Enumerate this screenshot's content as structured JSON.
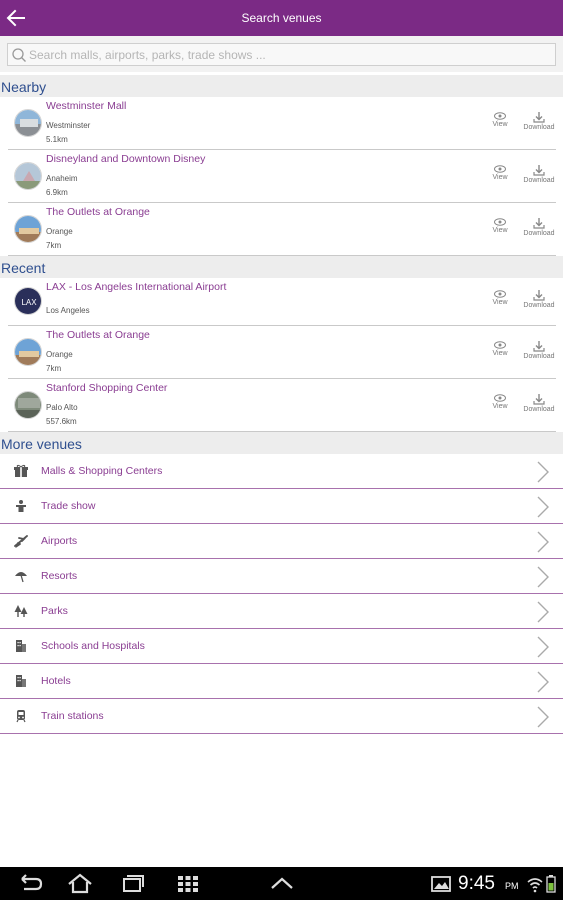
{
  "appbar": {
    "title": "Search venues"
  },
  "search": {
    "placeholder": "Search malls, airports, parks, trade shows ..."
  },
  "sections": {
    "nearby": "Nearby",
    "recent": "Recent",
    "more": "More venues"
  },
  "actions": {
    "view": "View",
    "download": "Download"
  },
  "nearby": [
    {
      "name": "Westminster Mall",
      "city": "Westminster",
      "dist": "5.1km"
    },
    {
      "name": "Disneyland and Downtown Disney",
      "city": "Anaheim",
      "dist": "6.9km"
    },
    {
      "name": "The Outlets at Orange",
      "city": "Orange",
      "dist": "7km"
    }
  ],
  "recent": [
    {
      "name": "LAX - Los Angeles International Airport",
      "city": "Los Angeles",
      "dist": ""
    },
    {
      "name": "The Outlets at Orange",
      "city": "Orange",
      "dist": "7km"
    },
    {
      "name": "Stanford Shopping Center",
      "city": "Palo Alto",
      "dist": "557.6km"
    }
  ],
  "categories": [
    {
      "label": "Malls & Shopping Centers",
      "icon": "gift-icon"
    },
    {
      "label": "Trade show",
      "icon": "podium-icon"
    },
    {
      "label": "Airports",
      "icon": "airplane-icon"
    },
    {
      "label": "Resorts",
      "icon": "umbrella-icon"
    },
    {
      "label": "Parks",
      "icon": "trees-icon"
    },
    {
      "label": "Schools and Hospitals",
      "icon": "building-icon"
    },
    {
      "label": "Hotels",
      "icon": "hotel-icon"
    },
    {
      "label": "Train stations",
      "icon": "train-icon"
    }
  ],
  "statusbar": {
    "time": "9:45",
    "ampm": "PM"
  },
  "colors": {
    "accent": "#7b2a85",
    "section_text": "#2f4f8f",
    "link_text": "#8a3d92"
  }
}
